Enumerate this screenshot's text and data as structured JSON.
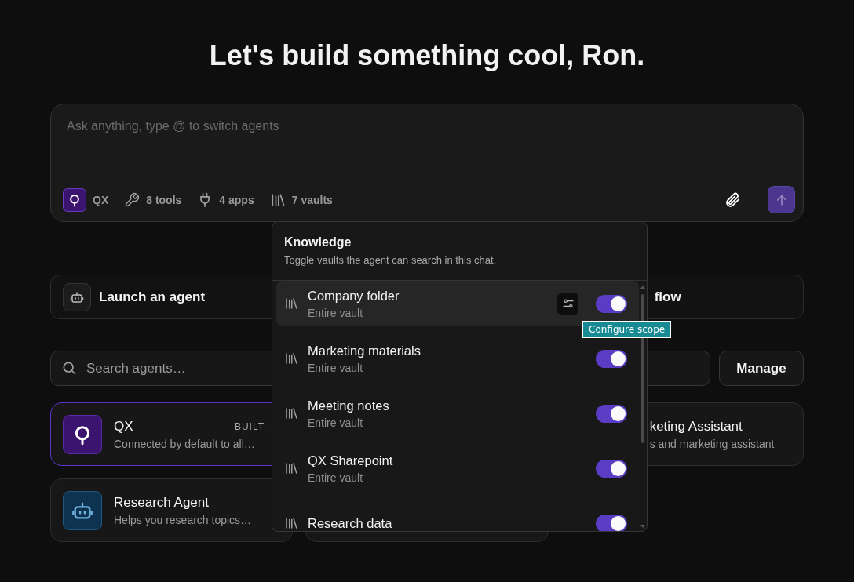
{
  "heading": "Let's build something cool, Ron.",
  "composer": {
    "placeholder": "Ask anything, type @ to switch agents",
    "agent": "QX",
    "tools": [
      {
        "kind": "tools",
        "label": "8 tools"
      },
      {
        "kind": "apps",
        "label": "4 apps"
      },
      {
        "kind": "vaults",
        "label": "7 vaults"
      }
    ]
  },
  "quick_actions": [
    {
      "kind": "full",
      "label": "Launch an agent"
    },
    {
      "kind": "covered",
      "label": "flow"
    }
  ],
  "search": {
    "placeholder": "Search agents…"
  },
  "manage_button": "Manage",
  "agents": [
    {
      "kind": "builtin",
      "name": "QX",
      "badge": "BUILT-",
      "description": "Connected by default to all…",
      "selected": true
    },
    {
      "kind": "covered",
      "name": "keting Assistant",
      "description": "s and marketing assistant",
      "selected": false
    },
    {
      "kind": "custom",
      "name": "Research Agent",
      "description": "Helps you research topics…",
      "selected": false
    },
    {
      "kind": "blank",
      "selected": false
    }
  ],
  "knowledge": {
    "title": "Knowledge",
    "subtitle": "Toggle vaults the agent can search in this chat.",
    "tooltip": "Configure scope",
    "vaults": [
      {
        "name": "Company folder",
        "scope": "Entire vault",
        "on": true,
        "hovered": true
      },
      {
        "name": "Marketing materials",
        "scope": "Entire vault",
        "on": true,
        "hovered": false
      },
      {
        "name": "Meeting notes",
        "scope": "Entire vault",
        "on": true,
        "hovered": false
      },
      {
        "name": "QX Sharepoint",
        "scope": "Entire vault",
        "on": true,
        "hovered": false
      },
      {
        "name": "Research data",
        "on": true,
        "hovered": false
      }
    ]
  }
}
